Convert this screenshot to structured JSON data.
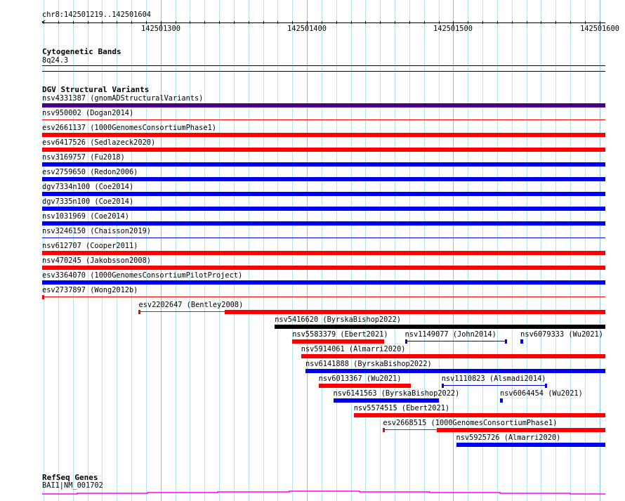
{
  "location": "chr8:142501219..142501604",
  "ruler": {
    "start": 142501219,
    "end": 142501604,
    "tick_labels": [
      "142501300",
      "142501400",
      "142501500",
      "142501600"
    ]
  },
  "tracks": {
    "cytoband": {
      "title": "Cytogenetic Bands",
      "band": "8q24.3"
    },
    "dgv": {
      "title": "DGV Structural Variants",
      "colors": {
        "red": "#ff0000",
        "blue": "#0000ee",
        "purple": "#4b0082",
        "black": "#000000"
      },
      "features": [
        {
          "row": 0,
          "label": "nsv4331387 (gnomADStructuralVariants)",
          "color": "purple",
          "start": 142501219,
          "end": 142501610
        },
        {
          "row": 1,
          "label": "nsv950002 (Dogan2014)",
          "color": "red",
          "start": 142501219,
          "end": 142501610,
          "thin": true
        },
        {
          "row": 2,
          "label": "esv2661137 (1000GenomesConsortiumPhase1)",
          "color": "red",
          "start": 142501219,
          "end": 142501610
        },
        {
          "row": 3,
          "label": "esv6417526 (Sedlazeck2020)",
          "color": "red",
          "start": 142501219,
          "end": 142501610
        },
        {
          "row": 4,
          "label": "nsv3169757 (Fu2018)",
          "color": "blue",
          "start": 142501219,
          "end": 142501610
        },
        {
          "row": 5,
          "label": "esv2759650 (Redon2006)",
          "color": "blue",
          "start": 142501219,
          "end": 142501610
        },
        {
          "row": 6,
          "label": "dgv7334n100 (Coe2014)",
          "color": "blue",
          "start": 142501219,
          "end": 142501610
        },
        {
          "row": 7,
          "label": "dgv7335n100 (Coe2014)",
          "color": "blue",
          "start": 142501219,
          "end": 142501610
        },
        {
          "row": 8,
          "label": "nsv1031969 (Coe2014)",
          "color": "blue",
          "start": 142501219,
          "end": 142501610
        },
        {
          "row": 9,
          "label": "nsv3246150 (Chaisson2019)",
          "color": "blue",
          "start": 142501219,
          "end": 142501610,
          "thin": true
        },
        {
          "row": 10,
          "label": "nsv612707 (Cooper2011)",
          "color": "red",
          "start": 142501219,
          "end": 142501610
        },
        {
          "row": 11,
          "label": "nsv470245 (Jakobsson2008)",
          "color": "red",
          "start": 142501219,
          "end": 142501610
        },
        {
          "row": 12,
          "label": "esv3364070 (1000GenomesConsortiumPilotProject)",
          "color": "blue",
          "start": 142501219,
          "end": 142501610
        },
        {
          "row": 13,
          "label": "esv2737897 (Wong2012b)",
          "color": "red",
          "start": 142501219,
          "end": 142501610,
          "thin": true,
          "cap_start": true
        },
        {
          "row": 14,
          "label": "esv2202647 (Bentley2008)",
          "color": "red",
          "start": 142501285,
          "end": 142501610,
          "thick_start": 142501344,
          "cap_start": true
        },
        {
          "row": 15,
          "label": "nsv5416620 (ByrskaBishop2022)",
          "color": "black",
          "start": 142501378,
          "end": 142501610
        },
        {
          "row": 16,
          "label": "nsv5583379 (Ebert2021)",
          "color": "red",
          "start": 142501390,
          "end": 142501453
        },
        {
          "row": 16,
          "label": "nsv1149077 (John2014)",
          "color": "blue",
          "start": 142501467,
          "end": 142501537,
          "thin": true,
          "cap_start": true,
          "cap_end": true
        },
        {
          "row": 16,
          "label": "nsv6079333 (Wu2021)",
          "color": "blue",
          "start": 142501546,
          "end": 142501548
        },
        {
          "row": 17,
          "label": "nsv5914061 (Almarri2020)",
          "color": "red",
          "start": 142501396,
          "end": 142501610
        },
        {
          "row": 18,
          "label": "nsv6141888 (ByrskaBishop2022)",
          "color": "blue",
          "start": 142501399,
          "end": 142501610
        },
        {
          "row": 19,
          "label": "nsv6013367 (Wu2021)",
          "color": "red",
          "start": 142501408,
          "end": 142501471
        },
        {
          "row": 19,
          "label": "nsv1110823 (Alsmadi2014)",
          "color": "blue",
          "start": 142501492,
          "end": 142501564,
          "thin": true,
          "cap_start": true,
          "cap_end": true
        },
        {
          "row": 20,
          "label": "nsv6141563 (ByrskaBishop2022)",
          "color": "blue",
          "start": 142501418,
          "end": 142501490
        },
        {
          "row": 20,
          "label": "nsv6064454 (Wu2021)",
          "color": "blue",
          "start": 142501532,
          "end": 142501534
        },
        {
          "row": 21,
          "label": "nsv5574515 (Ebert2021)",
          "color": "red",
          "start": 142501432,
          "end": 142501610
        },
        {
          "row": 22,
          "label": "esv2668515 (1000GenomesConsortiumPhase1)",
          "color": "red",
          "start": 142501452,
          "end": 142501610,
          "thick_start": 142501489,
          "cap_start": true
        },
        {
          "row": 23,
          "label": "nsv5925726 (Almarri2020)",
          "color": "blue",
          "start": 142501502,
          "end": 142501610
        }
      ]
    },
    "refseq": {
      "title": "RefSeq Genes",
      "gene": "BAI1|NM_001702",
      "color": "#ff00ff"
    }
  }
}
